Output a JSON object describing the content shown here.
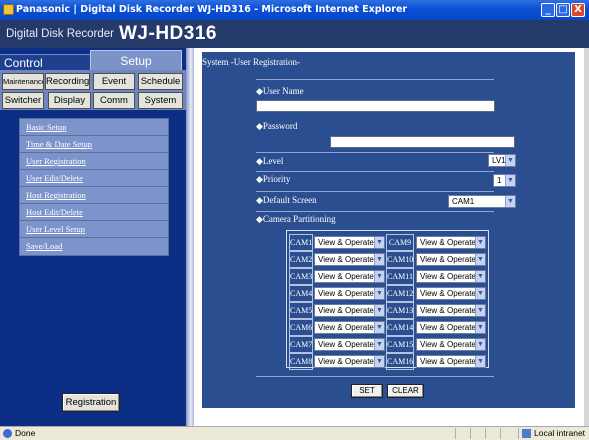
{
  "window": {
    "title": "Panasonic | Digital Disk Recorder WJ-HD316 - Microsoft Internet Explorer",
    "buttons": {
      "minimize": "_",
      "maximize": "□",
      "close": "X"
    }
  },
  "header": {
    "brand": "Digital Disk Recorder",
    "model": "WJ-HD316"
  },
  "sidebar": {
    "tabs": {
      "control": "Control",
      "setup": "Setup"
    },
    "nav_tabs": [
      "Maintenance",
      "Recording",
      "Event",
      "Schedule",
      "Switcher",
      "Display",
      "Comm",
      "System"
    ],
    "menu_items": [
      "Basic Setup",
      "Time & Date Setup",
      "User Registration",
      "User Edit/Delete",
      "Host Registration",
      "Host Edit/Delete",
      "User Level Setup",
      "Save/Load"
    ],
    "registration_button": "Registration"
  },
  "content": {
    "breadcrumb": "System -User Registration-",
    "fields": {
      "user_name_label": "◆User Name",
      "user_name_value": "",
      "password_label": "◆Password",
      "password_value": "",
      "level_label": "◆Level",
      "level_value": "LV1",
      "priority_label": "◆Priority",
      "priority_value": "1",
      "default_screen_label": "◆Default Screen",
      "default_screen_value": "CAM1",
      "camera_partitioning_label": "◆Camera Partitioning"
    },
    "cameras": [
      {
        "left": "CAM1",
        "left_value": "View & Operate",
        "right": "CAM9",
        "right_value": "View & Operate"
      },
      {
        "left": "CAM2",
        "left_value": "View & Operate",
        "right": "CAM10",
        "right_value": "View & Operate"
      },
      {
        "left": "CAM3",
        "left_value": "View & Operate",
        "right": "CAM11",
        "right_value": "View & Operate"
      },
      {
        "left": "CAM4",
        "left_value": "View & Operate",
        "right": "CAM12",
        "right_value": "View & Operate"
      },
      {
        "left": "CAM5",
        "left_value": "View & Operate",
        "right": "CAM13",
        "right_value": "View & Operate"
      },
      {
        "left": "CAM6",
        "left_value": "View & Operate",
        "right": "CAM14",
        "right_value": "View & Operate"
      },
      {
        "left": "CAM7",
        "left_value": "View & Operate",
        "right": "CAM15",
        "right_value": "View & Operate"
      },
      {
        "left": "CAM8",
        "left_value": "View & Operate",
        "right": "CAM16",
        "right_value": "View & Operate"
      }
    ],
    "buttons": {
      "set": "SET",
      "clear": "CLEAR"
    }
  },
  "statusbar": {
    "status": "Done",
    "zone": "Local intranet"
  },
  "colors": {
    "header_bg": "#243a6a",
    "sidebar_bg": "#0d2e85",
    "panel_bg": "#2a4e90",
    "menu_panel": "#7d93cb",
    "titlebar": "#0a4fd6"
  }
}
